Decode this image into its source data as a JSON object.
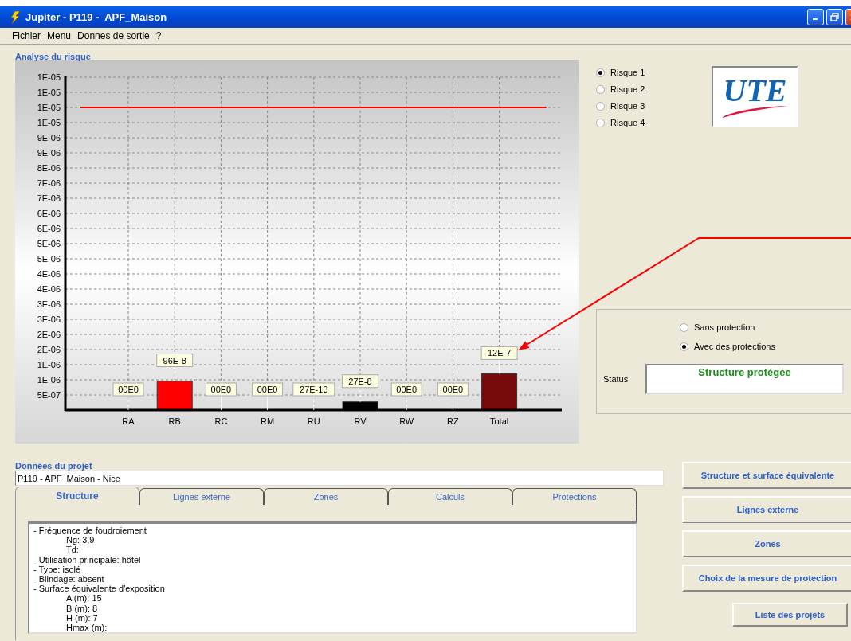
{
  "window": {
    "title": "Jupiter - P119 -  APF_Maison"
  },
  "menu": [
    "Fichier",
    "Menu",
    "Donnes de sortie",
    "?"
  ],
  "risk_analysis": {
    "heading": "Analyse du risque",
    "chart_data": {
      "type": "bar",
      "categories": [
        "RA",
        "RB",
        "RC",
        "RM",
        "RU",
        "RV",
        "RW",
        "RZ",
        "Total"
      ],
      "series": [
        {
          "color": "#ff0000",
          "values": [
            0,
            9.6e-07,
            0,
            0,
            2.7e-12,
            null,
            0,
            0,
            null
          ]
        },
        {
          "color": "#000000",
          "values": [
            null,
            null,
            null,
            null,
            null,
            2.7e-07,
            null,
            null,
            null
          ]
        },
        {
          "color": "#770b0b",
          "values": [
            null,
            null,
            null,
            null,
            null,
            null,
            null,
            null,
            1.2e-06
          ]
        }
      ],
      "ylim": [
        0,
        1.1e-05
      ],
      "yticks": [
        {
          "value": 5e-07,
          "label": "5E-07"
        },
        {
          "value": 1e-06,
          "label": "1E-06"
        },
        {
          "value": 1.5e-06,
          "label": "1E-06"
        },
        {
          "value": 2e-06,
          "label": "2E-06"
        },
        {
          "value": 2.5e-06,
          "label": "2E-06"
        },
        {
          "value": 3e-06,
          "label": "3E-06"
        },
        {
          "value": 3.5e-06,
          "label": "3E-06"
        },
        {
          "value": 4e-06,
          "label": "4E-06"
        },
        {
          "value": 4.5e-06,
          "label": "4E-06"
        },
        {
          "value": 5e-06,
          "label": "5E-06"
        },
        {
          "value": 5.5e-06,
          "label": "5E-06"
        },
        {
          "value": 6e-06,
          "label": "6E-06"
        },
        {
          "value": 6.5e-06,
          "label": "6E-06"
        },
        {
          "value": 7e-06,
          "label": "7E-06"
        },
        {
          "value": 7.5e-06,
          "label": "7E-06"
        },
        {
          "value": 8e-06,
          "label": "8E-06"
        },
        {
          "value": 8.5e-06,
          "label": "9E-06"
        },
        {
          "value": 9e-06,
          "label": "9E-06"
        },
        {
          "value": 9.5e-06,
          "label": "1E-05"
        },
        {
          "value": 1e-05,
          "label": "1E-05"
        },
        {
          "value": 1.05e-05,
          "label": "1E-05"
        },
        {
          "value": 1.1e-05,
          "label": "1E-05"
        }
      ],
      "value_labels": [
        "00E0",
        "96E-8",
        "00E0",
        "00E0",
        "27E-13",
        "27E-8",
        "00E0",
        "00E0",
        "12E-7"
      ],
      "grid": true,
      "ref_lines": [
        {
          "axis": "y",
          "value": 1e-05,
          "color": "#ff0000"
        }
      ]
    }
  },
  "risk_options": [
    {
      "label": "Risque 1",
      "selected": true
    },
    {
      "label": "Risque 2",
      "selected": false
    },
    {
      "label": "Risque 3",
      "selected": false
    },
    {
      "label": "Risque 4",
      "selected": false
    }
  ],
  "logo": {
    "text": "UTE"
  },
  "protection": {
    "options": [
      {
        "label": "Sans protection",
        "selected": false
      },
      {
        "label": "Avec des protections",
        "selected": true
      }
    ],
    "status_label": "Status",
    "status": "Structure protégée"
  },
  "project": {
    "heading": "Données du projet",
    "name": "P119 - APF_Maison - Nice",
    "tabs": [
      {
        "label": "Structure",
        "selected": true
      },
      {
        "label": "Lignes externe",
        "selected": false
      },
      {
        "label": "Zones",
        "selected": false
      },
      {
        "label": "Calculs",
        "selected": false
      },
      {
        "label": "Protections",
        "selected": false
      }
    ],
    "details": [
      {
        "text": "- Fréquence de foudroiement",
        "children": [
          {
            "text": "Ng: 3,9"
          },
          {
            "text": "Td:"
          }
        ]
      },
      {
        "text": "- Utilisation principale: hôtel"
      },
      {
        "text": "- Type: isolé"
      },
      {
        "text": "- Blindage: absent"
      },
      {
        "text": "- Surface équivalente d'exposition",
        "children": [
          {
            "text": "A (m): 15"
          },
          {
            "text": "B (m): 8"
          },
          {
            "text": "H (m): 7"
          },
          {
            "text": "Hmax (m):"
          }
        ]
      }
    ]
  },
  "buttons": [
    "Structure et surface équivalente",
    "Lignes externe",
    "Zones",
    "Choix de la mesure de protection"
  ],
  "list_button": "Liste des projets"
}
